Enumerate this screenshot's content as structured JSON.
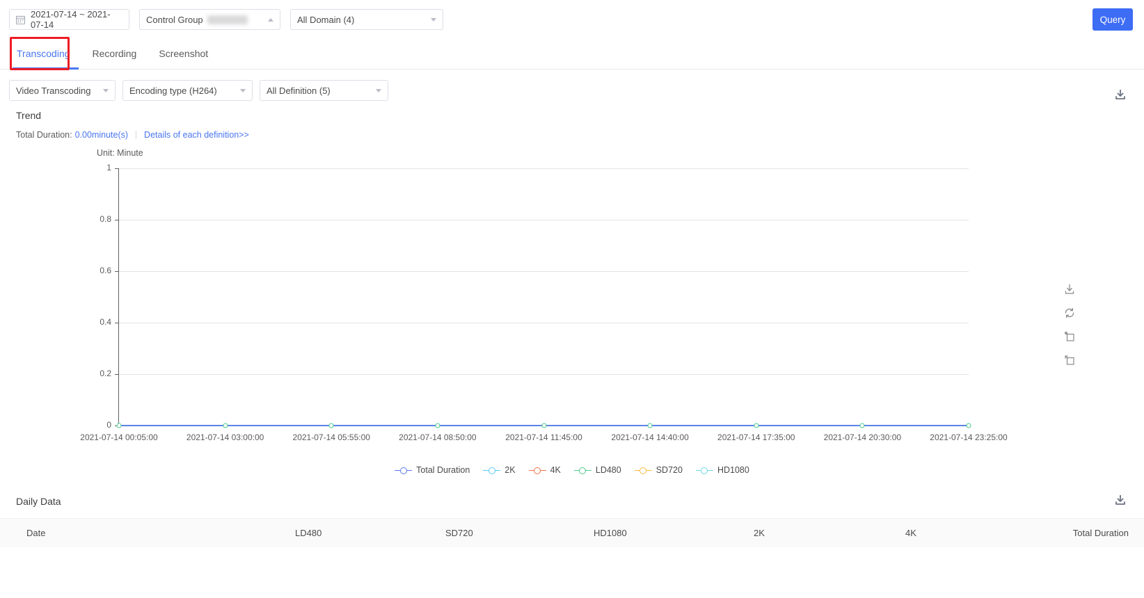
{
  "topbar": {
    "date_range": "2021-07-14 ~ 2021-07-14",
    "calendar_icon": "calendar-icon",
    "control_group_label": "Control Group",
    "control_group_value_masked": "",
    "all_domain_label": "All Domain (4)",
    "query_label": "Query",
    "accent_color": "#3d6cf5"
  },
  "tabs": {
    "items": [
      {
        "label": "Transcoding",
        "active": true
      },
      {
        "label": "Recording",
        "active": false
      },
      {
        "label": "Screenshot",
        "active": false
      }
    ],
    "highlight_color": "#ee1c25",
    "active_color": "#4a76f0"
  },
  "filters": {
    "type_label": "Video Transcoding",
    "encoding_label": "Encoding type (H264)",
    "definition_label": "All Definition (5)"
  },
  "trend": {
    "title": "Trend",
    "download_icon": "download-icon",
    "summary_label": "Total Duration:",
    "summary_value": "0.00minute(s)",
    "details_link": "Details of each definition>>"
  },
  "chart_tools": [
    {
      "name": "save-image-icon",
      "label": "Save as image"
    },
    {
      "name": "restore-icon",
      "label": "Restore"
    },
    {
      "name": "data-zoom-icon",
      "label": "Zoom"
    },
    {
      "name": "data-zoom-reset-icon",
      "label": "Zoom reset"
    }
  ],
  "daily": {
    "title": "Daily Data",
    "download_icon": "download-icon",
    "columns": [
      "Date",
      "LD480",
      "SD720",
      "HD1080",
      "2K",
      "4K",
      "Total Duration"
    ]
  },
  "chart_data": {
    "type": "line",
    "title": "Trend",
    "unit_label": "Unit: Minute",
    "xlabel": "",
    "ylabel": "Minute",
    "ylim": [
      0,
      1
    ],
    "yticks": [
      0,
      0.2,
      0.4,
      0.6,
      0.8,
      1
    ],
    "ytick_labels": [
      "0",
      "0.2",
      "0.4",
      "0.6",
      "0.8",
      "1"
    ],
    "grid": true,
    "legend_position": "bottom",
    "categories": [
      "2021-07-14 00:05:00",
      "2021-07-14 03:00:00",
      "2021-07-14 05:55:00",
      "2021-07-14 08:50:00",
      "2021-07-14 11:45:00",
      "2021-07-14 14:40:00",
      "2021-07-14 17:35:00",
      "2021-07-14 20:30:00",
      "2021-07-14 23:25:00"
    ],
    "series": [
      {
        "name": "Total Duration",
        "color": "#5b78e8",
        "values": [
          0,
          0,
          0,
          0,
          0,
          0,
          0,
          0,
          0
        ]
      },
      {
        "name": "2K",
        "color": "#5ac8f5",
        "values": [
          0,
          0,
          0,
          0,
          0,
          0,
          0,
          0,
          0
        ]
      },
      {
        "name": "4K",
        "color": "#f2724b",
        "values": [
          0,
          0,
          0,
          0,
          0,
          0,
          0,
          0,
          0
        ]
      },
      {
        "name": "LD480",
        "color": "#4ecb8a",
        "values": [
          0,
          0,
          0,
          0,
          0,
          0,
          0,
          0,
          0
        ]
      },
      {
        "name": "SD720",
        "color": "#f8b93c",
        "values": [
          0,
          0,
          0,
          0,
          0,
          0,
          0,
          0,
          0
        ]
      },
      {
        "name": "HD1080",
        "color": "#6fd8e8",
        "values": [
          0,
          0,
          0,
          0,
          0,
          0,
          0,
          0,
          0
        ]
      }
    ]
  }
}
